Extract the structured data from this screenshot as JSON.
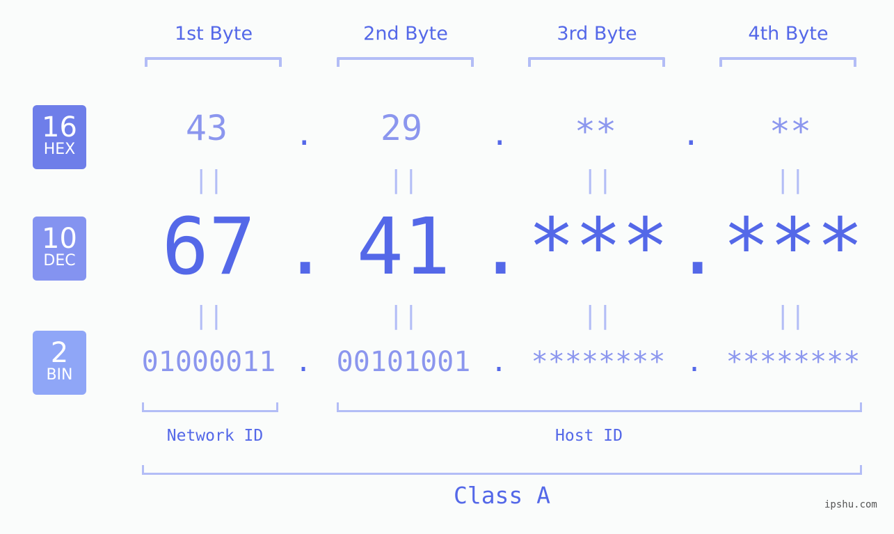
{
  "headers": [
    "1st Byte",
    "2nd Byte",
    "3rd Byte",
    "4th Byte"
  ],
  "badges": [
    {
      "num": "16",
      "label": "HEX",
      "color": "#6e7ee9"
    },
    {
      "num": "10",
      "label": "DEC",
      "color": "#8493f0"
    },
    {
      "num": "2",
      "label": "BIN",
      "color": "#8fa6f7"
    }
  ],
  "hex": [
    "43",
    "29",
    "**",
    "**"
  ],
  "dec": [
    "67",
    "41",
    "***",
    "***"
  ],
  "bin": [
    "01000011",
    "00101001",
    "********",
    "********"
  ],
  "separator": ".",
  "equals": "||",
  "network_label": "Network ID",
  "host_label": "Host ID",
  "class_label": "Class A",
  "watermark": "ipshu.com",
  "colors": {
    "primary": "#5468e8",
    "light": "#8b96ee",
    "bracket": "#b3bdf6"
  }
}
